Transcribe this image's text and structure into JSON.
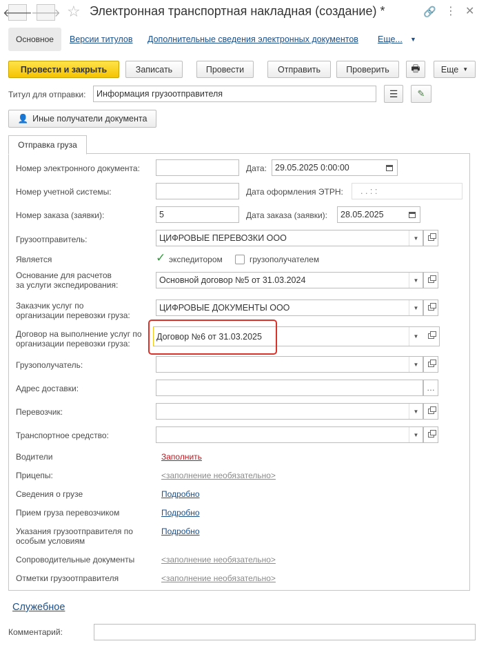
{
  "window": {
    "title": "Электронная транспортная накладная (создание) *",
    "back_icon": "arrow-left-icon",
    "forward_icon": "arrow-right-icon"
  },
  "tabs_top": {
    "active": "Основное",
    "links": [
      "Версии титулов",
      "Дополнительные сведения электронных документов",
      "Еще..."
    ]
  },
  "toolbar": {
    "post_close": "Провести и закрыть",
    "save": "Записать",
    "post": "Провести",
    "send": "Отправить",
    "check": "Проверить",
    "more": "Еще"
  },
  "title_row": {
    "label": "Титул для отправки:",
    "value": "Информация грузоотправителя"
  },
  "other_recipients": "Иные получатели документа",
  "section_tab": "Отправка груза",
  "form": {
    "doc_number_label": "Номер электронного документа:",
    "doc_number_value": "",
    "date_label": "Дата:",
    "date_value": "29.05.2025  0:00:00",
    "account_number_label": "Номер учетной системы:",
    "account_number_value": "",
    "etrn_date_label": "Дата оформления ЭТРН:",
    "etrn_date_value": ".  .      :  :",
    "order_number_label": "Номер заказа (заявки):",
    "order_number_value": "5",
    "order_date_label": "Дата заказа (заявки):",
    "order_date_value": "28.05.2025",
    "shipper_label": "Грузоотправитель:",
    "shipper_value": "ЦИФРОВЫЕ ПЕРЕВОЗКИ ООО",
    "is_label": "Является",
    "forwarder_label": "экспедитором",
    "consignee_check_label": "грузополучателем",
    "basis_label_1": "Основание для расчетов",
    "basis_label_2": "за услуги экспедирования:",
    "basis_value": "Основной договор №5 от 31.03.2024",
    "customer_label_1": "Заказчик услуг по",
    "customer_label_2": "организации перевозки груза:",
    "customer_value": "ЦИФРОВЫЕ ДОКУМЕНТЫ ООО",
    "contract_label_1": "Договор на выполнение услуг по",
    "contract_label_2": "организации перевозки груза:",
    "contract_value": "Договор №6 от 31.03.2025",
    "consignee_label": "Грузополучатель:",
    "consignee_value": "",
    "delivery_address_label": "Адрес доставки:",
    "delivery_address_value": "",
    "carrier_label": "Перевозчик:",
    "carrier_value": "",
    "vehicle_label": "Транспортное средство:",
    "vehicle_value": "",
    "drivers_label": "Водители",
    "drivers_link": "Заполнить",
    "trailers_label": "Прицепы:",
    "optional_link": "<заполнение необязательно>",
    "cargo_label": "Сведения о грузе",
    "details_link": "Подробно",
    "acceptance_label": "Прием груза перевозчиком",
    "instructions_label_1": "Указания грузоотправителя по",
    "instructions_label_2": "особым условиям",
    "accompanying_label": "Сопроводительные документы",
    "marks_label": "Отметки грузоотправителя"
  },
  "service_link": "Служебное",
  "comment_label": "Комментарий:",
  "comment_value": "",
  "colors": {
    "primary_button": "#f5c400",
    "link": "#1a4f8b",
    "red_link": "#c8141c",
    "highlight_box": "#d9322b",
    "focus_border": "#f0c419"
  }
}
